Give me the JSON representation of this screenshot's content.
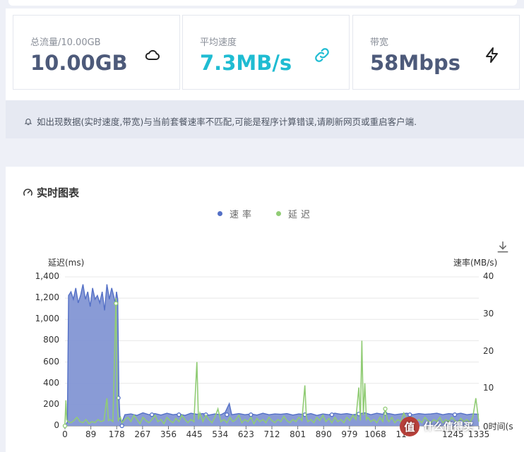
{
  "stats": [
    {
      "label": "总流量/10.00GB",
      "value": "10.00GB",
      "icon": "cloud-icon",
      "color": "#4d5a7a"
    },
    {
      "label": "平均速度",
      "value": "7.3MB/s",
      "icon": "link-icon",
      "color": "#1fbcd2"
    },
    {
      "label": "带宽",
      "value": "58Mbps",
      "icon": "lightning-icon",
      "color": "#4d5a7a"
    }
  ],
  "notice": {
    "icon": "bell-icon",
    "text": "如出现数据(实时速度,带宽)与当前套餐速率不匹配,可能是程序计算错误,请刷新网页或重启客户端."
  },
  "card": {
    "title": "实时图表",
    "title_icon": "gauge-icon",
    "download_icon": "download-icon"
  },
  "watermark": {
    "badge": "值",
    "text": "什么值得买"
  },
  "chart_data": {
    "type": "line",
    "legend": [
      {
        "name": "速率",
        "color": "#5470c6"
      },
      {
        "name": "延迟",
        "color": "#91cc75"
      }
    ],
    "y_left": {
      "label": "延迟(ms)",
      "min": 0,
      "max": 1400,
      "ticks": [
        "0",
        "200",
        "400",
        "600",
        "800",
        "1,000",
        "1,200",
        "1,400"
      ]
    },
    "y_right": {
      "label": "速率(MB/s)",
      "min": 0,
      "max": 40,
      "ticks": [
        "0",
        "10",
        "20",
        "30",
        "40"
      ],
      "partial_label": "0时间(s"
    },
    "x": {
      "min": 0,
      "max": 1380,
      "ticks": [
        "0",
        "89",
        "178",
        "267",
        "356",
        "445",
        "534",
        "623",
        "712",
        "801",
        "890",
        "979",
        "1068",
        "11",
        "",
        "1245",
        "1335"
      ]
    },
    "series": [
      {
        "name": "速率",
        "axis": "right",
        "color": "#5470c6",
        "fill": "#8396d4",
        "points": [
          [
            0,
            0
          ],
          [
            4,
            0.5
          ],
          [
            8,
            1
          ],
          [
            12,
            35
          ],
          [
            20,
            36
          ],
          [
            28,
            34
          ],
          [
            36,
            37
          ],
          [
            44,
            33
          ],
          [
            52,
            35
          ],
          [
            60,
            38
          ],
          [
            68,
            34
          ],
          [
            76,
            36
          ],
          [
            84,
            32
          ],
          [
            92,
            37
          ],
          [
            100,
            34
          ],
          [
            108,
            35
          ],
          [
            116,
            33
          ],
          [
            124,
            36
          ],
          [
            132,
            31
          ],
          [
            140,
            38
          ],
          [
            148,
            34
          ],
          [
            156,
            37
          ],
          [
            162,
            35
          ],
          [
            168,
            33
          ],
          [
            172,
            36
          ],
          [
            176,
            34
          ],
          [
            180,
            8
          ],
          [
            184,
            1.5
          ],
          [
            190,
            1
          ],
          [
            200,
            3
          ],
          [
            220,
            3.2
          ],
          [
            240,
            2.8
          ],
          [
            260,
            3.5
          ],
          [
            280,
            3
          ],
          [
            300,
            3.3
          ],
          [
            320,
            2.9
          ],
          [
            340,
            3.4
          ],
          [
            360,
            3
          ],
          [
            380,
            3.2
          ],
          [
            400,
            2.8
          ],
          [
            420,
            3.4
          ],
          [
            440,
            3.1
          ],
          [
            460,
            3.3
          ],
          [
            480,
            2.9
          ],
          [
            500,
            3.2
          ],
          [
            520,
            3
          ],
          [
            534,
            3.6
          ],
          [
            548,
            6
          ],
          [
            556,
            3
          ],
          [
            580,
            3.3
          ],
          [
            600,
            3
          ],
          [
            620,
            3.2
          ],
          [
            640,
            2.9
          ],
          [
            660,
            3.4
          ],
          [
            680,
            3
          ],
          [
            700,
            3.2
          ],
          [
            720,
            3.1
          ],
          [
            740,
            3.3
          ],
          [
            760,
            2.9
          ],
          [
            780,
            3.2
          ],
          [
            800,
            3
          ],
          [
            820,
            3.3
          ],
          [
            840,
            2.8
          ],
          [
            860,
            3.2
          ],
          [
            880,
            3
          ],
          [
            900,
            3.4
          ],
          [
            920,
            3.1
          ],
          [
            940,
            3.3
          ],
          [
            960,
            3
          ],
          [
            979,
            3.2
          ],
          [
            1000,
            3.5
          ],
          [
            1020,
            3
          ],
          [
            1040,
            3.4
          ],
          [
            1060,
            3.1
          ],
          [
            1080,
            3.3
          ],
          [
            1100,
            3
          ],
          [
            1120,
            3.2
          ],
          [
            1140,
            3.4
          ],
          [
            1160,
            3
          ],
          [
            1180,
            3.3
          ],
          [
            1200,
            3.1
          ],
          [
            1220,
            3.2
          ],
          [
            1240,
            3.4
          ],
          [
            1260,
            3
          ],
          [
            1280,
            3.3
          ],
          [
            1300,
            3.1
          ],
          [
            1320,
            3.4
          ],
          [
            1340,
            3
          ],
          [
            1360,
            3.2
          ],
          [
            1380,
            3.1
          ]
        ],
        "markers": [
          [
            190,
            0
          ],
          [
            178,
            7.5
          ],
          [
            290,
            3
          ],
          [
            380,
            3
          ],
          [
            470,
            3
          ],
          [
            540,
            3
          ],
          [
            620,
            3
          ],
          [
            800,
            3
          ],
          [
            890,
            3
          ],
          [
            980,
            3.2
          ],
          [
            1068,
            3.3
          ],
          [
            1150,
            3
          ],
          [
            1300,
            3
          ]
        ]
      },
      {
        "name": "延迟",
        "axis": "left",
        "color": "#91cc75",
        "points": [
          [
            0,
            20
          ],
          [
            3,
            240
          ],
          [
            6,
            60
          ],
          [
            10,
            40
          ],
          [
            20,
            30
          ],
          [
            30,
            50
          ],
          [
            40,
            80
          ],
          [
            50,
            40
          ],
          [
            60,
            30
          ],
          [
            70,
            60
          ],
          [
            80,
            20
          ],
          [
            90,
            40
          ],
          [
            100,
            30
          ],
          [
            110,
            60
          ],
          [
            120,
            40
          ],
          [
            130,
            50
          ],
          [
            140,
            260
          ],
          [
            145,
            50
          ],
          [
            150,
            60
          ],
          [
            160,
            40
          ],
          [
            170,
            1200
          ],
          [
            174,
            200
          ],
          [
            178,
            50
          ],
          [
            185,
            80
          ],
          [
            190,
            30
          ],
          [
            200,
            60
          ],
          [
            210,
            80
          ],
          [
            220,
            40
          ],
          [
            230,
            100
          ],
          [
            240,
            60
          ],
          [
            250,
            20
          ],
          [
            260,
            80
          ],
          [
            270,
            50
          ],
          [
            280,
            30
          ],
          [
            290,
            60
          ],
          [
            300,
            100
          ],
          [
            310,
            40
          ],
          [
            320,
            60
          ],
          [
            330,
            20
          ],
          [
            340,
            80
          ],
          [
            350,
            50
          ],
          [
            360,
            30
          ],
          [
            370,
            70
          ],
          [
            380,
            40
          ],
          [
            390,
            100
          ],
          [
            400,
            60
          ],
          [
            410,
            30
          ],
          [
            420,
            60
          ],
          [
            430,
            40
          ],
          [
            440,
            600
          ],
          [
            445,
            60
          ],
          [
            450,
            120
          ],
          [
            460,
            40
          ],
          [
            470,
            100
          ],
          [
            480,
            60
          ],
          [
            490,
            30
          ],
          [
            500,
            80
          ],
          [
            510,
            160
          ],
          [
            520,
            40
          ],
          [
            530,
            60
          ],
          [
            540,
            30
          ],
          [
            550,
            80
          ],
          [
            560,
            40
          ],
          [
            570,
            60
          ],
          [
            580,
            100
          ],
          [
            590,
            30
          ],
          [
            600,
            60
          ],
          [
            610,
            40
          ],
          [
            620,
            80
          ],
          [
            630,
            20
          ],
          [
            640,
            70
          ],
          [
            650,
            40
          ],
          [
            660,
            60
          ],
          [
            670,
            30
          ],
          [
            680,
            80
          ],
          [
            690,
            50
          ],
          [
            700,
            30
          ],
          [
            710,
            60
          ],
          [
            720,
            40
          ],
          [
            730,
            90
          ],
          [
            740,
            50
          ],
          [
            750,
            30
          ],
          [
            760,
            60
          ],
          [
            770,
            40
          ],
          [
            780,
            80
          ],
          [
            790,
            50
          ],
          [
            800,
            380
          ],
          [
            805,
            80
          ],
          [
            810,
            40
          ],
          [
            820,
            60
          ],
          [
            830,
            30
          ],
          [
            840,
            80
          ],
          [
            850,
            50
          ],
          [
            860,
            100
          ],
          [
            870,
            40
          ],
          [
            880,
            70
          ],
          [
            890,
            30
          ],
          [
            900,
            80
          ],
          [
            910,
            40
          ],
          [
            920,
            60
          ],
          [
            930,
            30
          ],
          [
            940,
            80
          ],
          [
            950,
            50
          ],
          [
            960,
            100
          ],
          [
            970,
            60
          ],
          [
            980,
            360
          ],
          [
            985,
            50
          ],
          [
            990,
            800
          ],
          [
            995,
            100
          ],
          [
            1000,
            400
          ],
          [
            1005,
            60
          ],
          [
            1010,
            80
          ],
          [
            1020,
            40
          ],
          [
            1030,
            60
          ],
          [
            1040,
            30
          ],
          [
            1050,
            80
          ],
          [
            1060,
            40
          ],
          [
            1068,
            160
          ],
          [
            1075,
            60
          ],
          [
            1080,
            40
          ],
          [
            1090,
            80
          ],
          [
            1100,
            30
          ],
          [
            1110,
            60
          ],
          [
            1120,
            40
          ],
          [
            1130,
            120
          ],
          [
            1140,
            60
          ],
          [
            1150,
            30
          ],
          [
            1160,
            80
          ],
          [
            1170,
            40
          ],
          [
            1180,
            60
          ],
          [
            1190,
            30
          ],
          [
            1200,
            80
          ],
          [
            1210,
            50
          ],
          [
            1220,
            30
          ],
          [
            1230,
            60
          ],
          [
            1240,
            40
          ],
          [
            1250,
            80
          ],
          [
            1260,
            30
          ],
          [
            1270,
            60
          ],
          [
            1280,
            40
          ],
          [
            1290,
            80
          ],
          [
            1300,
            50
          ],
          [
            1310,
            30
          ],
          [
            1320,
            70
          ],
          [
            1330,
            40
          ],
          [
            1340,
            60
          ],
          [
            1350,
            30
          ],
          [
            1360,
            80
          ],
          [
            1370,
            260
          ],
          [
            1380,
            40
          ]
        ],
        "markers": [
          [
            0,
            0
          ],
          [
            170,
            1150
          ],
          [
            1068,
            160
          ]
        ]
      }
    ]
  }
}
